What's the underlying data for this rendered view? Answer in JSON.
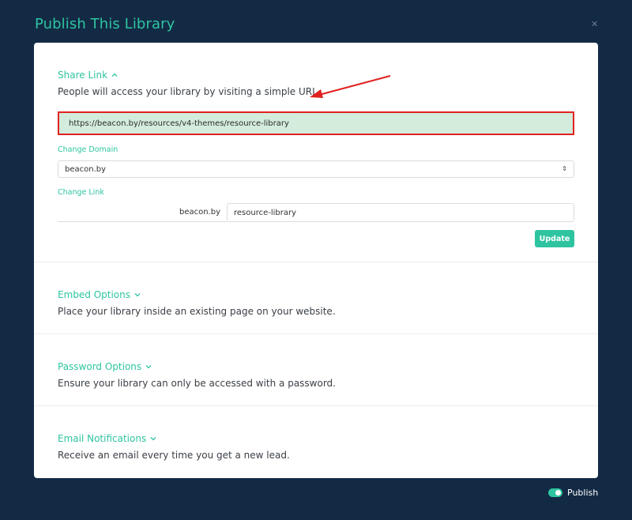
{
  "modal": {
    "title": "Publish This Library",
    "close_icon": "close-icon"
  },
  "share": {
    "heading": "Share Link",
    "heading_icon": "chevron-up-icon",
    "description": "People will access your library by visiting a simple URL.",
    "url": "https://beacon.by/resources/v4-themes/resource-library",
    "change_domain_label": "Change Domain",
    "domain_selected": "beacon.by",
    "change_link_label": "Change Link",
    "link_prefix": "beacon.by",
    "link_slug": "resource-library",
    "update_label": "Update"
  },
  "embed": {
    "heading": "Embed Options",
    "heading_icon": "chevron-down-icon",
    "description": "Place your library inside an existing page on your website."
  },
  "password": {
    "heading": "Password Options",
    "heading_icon": "chevron-down-icon",
    "description": "Ensure your library can only be accessed with a password."
  },
  "email": {
    "heading": "Email Notifications",
    "heading_icon": "chevron-down-icon",
    "description": "Receive an email every time you get a new lead."
  },
  "footer": {
    "publish_label": "Publish",
    "publish_on": true
  },
  "colors": {
    "accent": "#2ec4a0",
    "background": "#132a45",
    "highlight": "#d3ecdc",
    "annotation": "#e0221f"
  }
}
